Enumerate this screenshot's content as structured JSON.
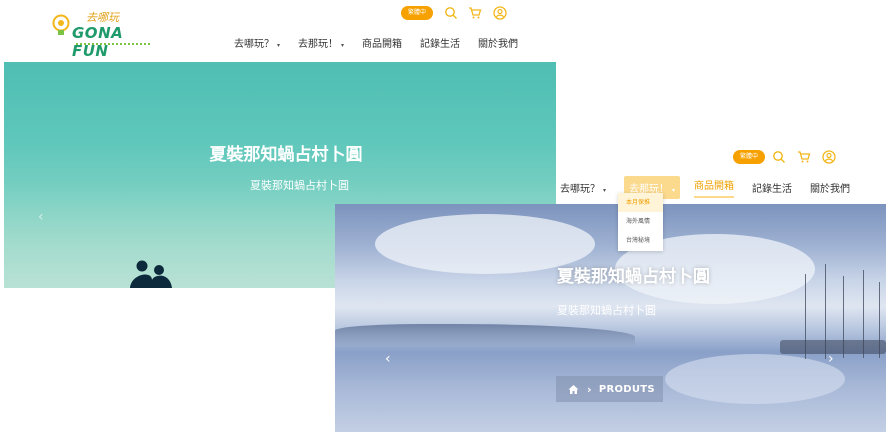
{
  "logo": {
    "small_text": "去哪玩",
    "brand": "GONA FUN"
  },
  "header1": {
    "lang_button": "繁體中",
    "nav": [
      {
        "label": "去哪玩？",
        "has_caret": true
      },
      {
        "label": "去那玩！",
        "has_caret": true
      },
      {
        "label": "商品開箱",
        "has_caret": false
      },
      {
        "label": "記錄生活",
        "has_caret": false
      },
      {
        "label": "關於我們",
        "has_caret": false
      }
    ]
  },
  "hero1": {
    "title": "夏裝那知蝸占村卜圓",
    "subtitle": "夏裝那知蝸占村卜圓",
    "prev_arrow": "‹",
    "next_arrow": "›"
  },
  "header2": {
    "lang_button": "繁體中",
    "nav": [
      {
        "label": "去哪玩？",
        "has_caret": true
      },
      {
        "label": "去那玩！",
        "has_caret": true,
        "state": "hover"
      },
      {
        "label": "商品開箱",
        "state": "current"
      },
      {
        "label": "記錄生活"
      },
      {
        "label": "關於我們"
      }
    ],
    "dropdown": [
      "本月保推",
      "海外風情",
      "台灣秘境"
    ]
  },
  "hero2": {
    "title": "夏裝那知蝸占村卜圓",
    "subtitle": "夏裝那知蝸占村卜圓",
    "prev_arrow": "‹",
    "next_arrow": "›",
    "breadcrumb": {
      "separator": "›",
      "page": "PRODUTS"
    }
  },
  "colors": {
    "accent": "#f7a100",
    "brand_green": "#1f9a6b",
    "hero1_sky": "#4fbeb3",
    "hero2_sky": "#9eb1d2"
  },
  "icons": [
    "lightbulb-icon",
    "search-icon",
    "cart-icon",
    "user-icon",
    "home-icon"
  ]
}
